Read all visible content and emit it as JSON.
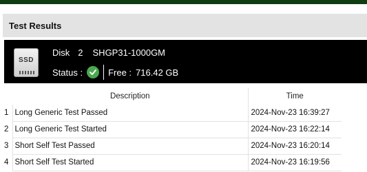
{
  "panel": {
    "title": "Test Results"
  },
  "disk": {
    "icon_label": "SSD",
    "label": "Disk",
    "number": "2",
    "model": "SHGP31-1000GM",
    "status_label": "Status :",
    "status_icon": "check-circle-icon",
    "status_color": "#4aa84f",
    "free_label": "Free :",
    "free_value": "716.42 GB"
  },
  "table": {
    "columns": [
      "Description",
      "Time"
    ],
    "rows": [
      {
        "index": "1",
        "description": "Long Generic Test Passed",
        "time": "2024-Nov-23 16:39:27"
      },
      {
        "index": "2",
        "description": "Long Generic Test Started",
        "time": "2024-Nov-23 16:22:14"
      },
      {
        "index": "3",
        "description": "Short Self Test Passed",
        "time": "2024-Nov-23 16:20:14"
      },
      {
        "index": "4",
        "description": "Short Self Test Started",
        "time": "2024-Nov-23 16:19:56"
      }
    ]
  }
}
